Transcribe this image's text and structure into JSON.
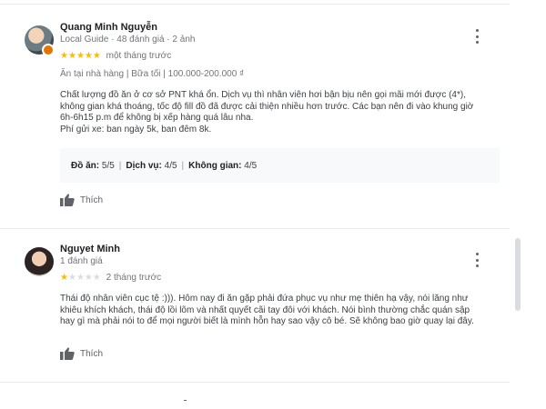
{
  "reviews": [
    {
      "name": "Quang Minh Nguyễn",
      "subtitle": "Local Guide · 48 đánh giá · 2 ảnh",
      "rating": 5,
      "when": "một tháng trước",
      "meta": "Ăn tại nhà hàng  |  Bữa tối  |  100.000-200.000 ₫",
      "text_lines": [
        "Chất lượng đồ ăn ở cơ sở PNT khá ổn. Dịch vụ thì nhân viên hơi bận bịu nên gọi mãi mới được (4*),",
        "không gian khá thoáng, tốc độ fill đồ đã được cải thiện nhiều hơn trước. Các bạn nên đi vào khung giờ",
        "6h-6h15 p.m để không bị xếp hàng quá lâu nha.",
        "Phí gửi xe: ban ngày 5k, ban đêm 8k."
      ],
      "ratings": {
        "food_label": "Đồ ăn:",
        "food_value": "5/5",
        "service_label": "Dịch vụ:",
        "service_value": "4/5",
        "space_label": "Không gian:",
        "space_value": "4/5"
      },
      "like_label": "Thích"
    },
    {
      "name": "Nguyet Minh",
      "subtitle": "1 đánh giá",
      "rating": 1,
      "when": "2 tháng trước",
      "text_lines": [
        "Thái độ nhân viên cục tệ :))). Hôm nay đi ăn gặp phải đứa phục vụ như mẹ thiên hạ vậy, nói lăng như",
        "khiêu khích khách, thái độ lồi lõm và nhất quyết cãi tay đôi với khách. Nói bình thường chắc quán sập",
        "hay gì mà phải nói to để mọi người biết là mình hỗn hay sao vậy cô bé. Sẽ không bao giờ quay lại đây."
      ],
      "like_label": "Thích"
    }
  ],
  "colors": {
    "star": "#fbbc04",
    "star_off": "#dadce0",
    "local_guide_badge": "#e37400"
  },
  "icons": {
    "more": "more-vert-icon",
    "like": "thumb-up-icon"
  }
}
